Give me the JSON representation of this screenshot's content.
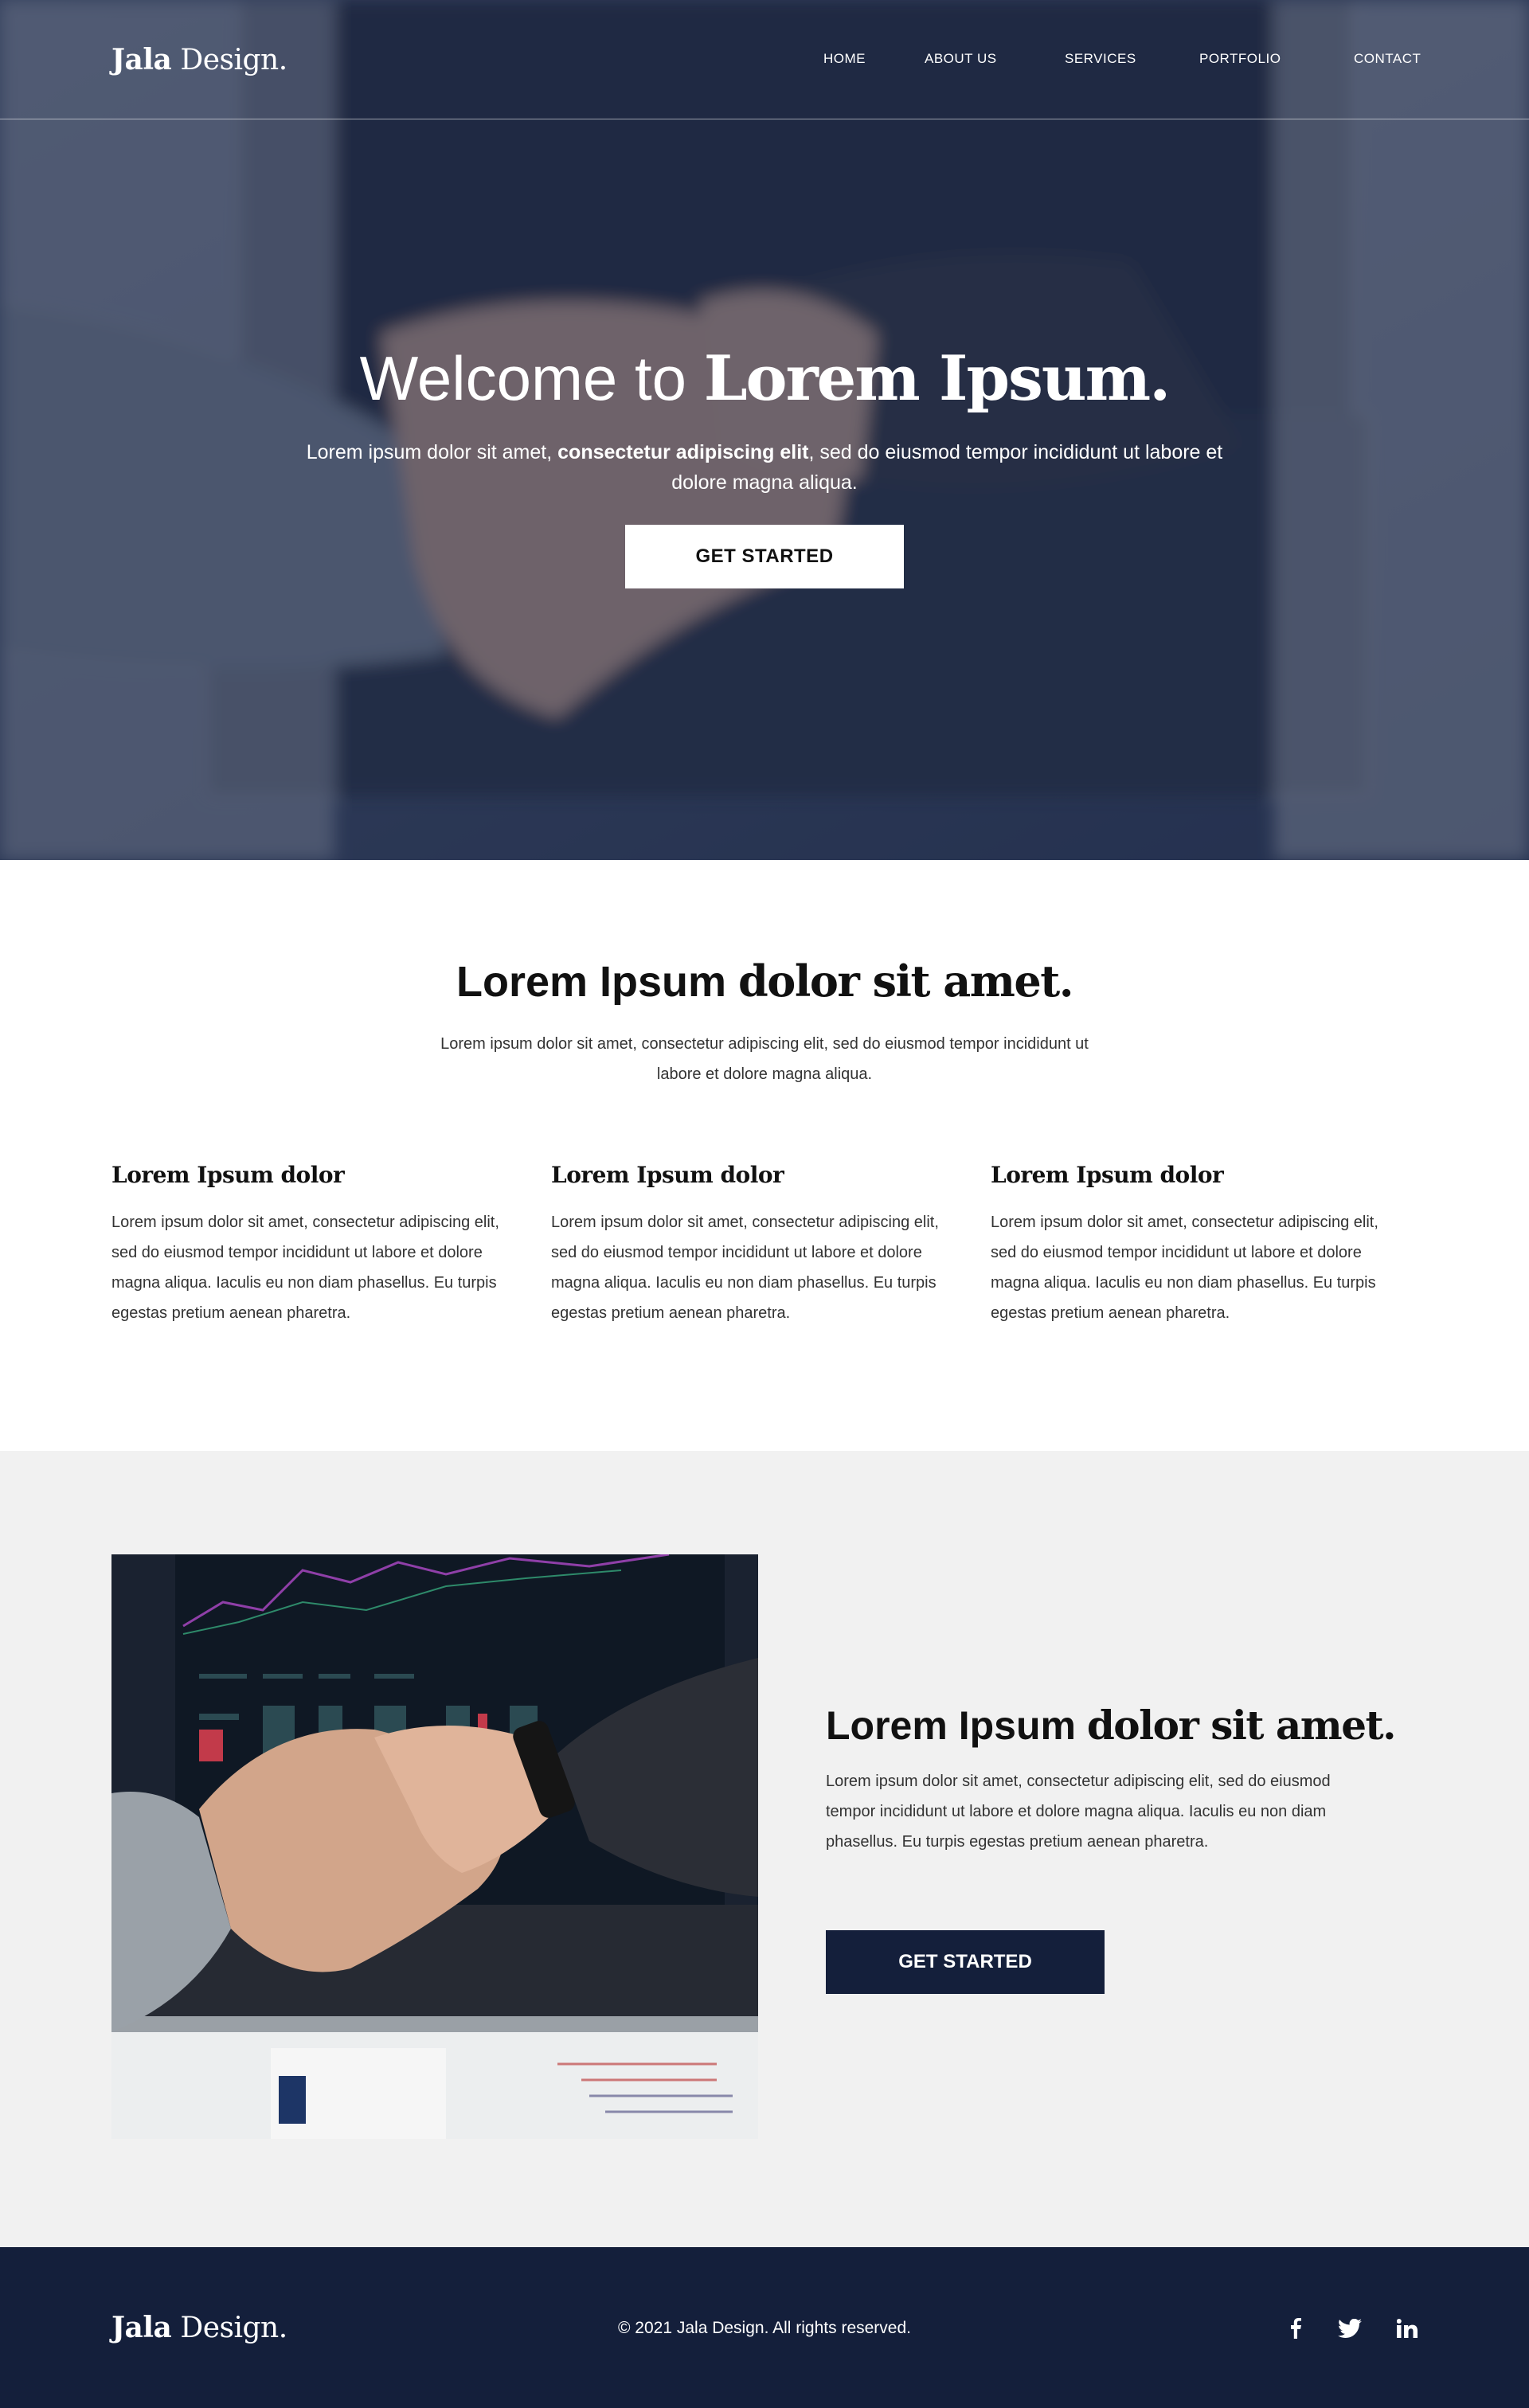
{
  "brand": {
    "logo_bold": "Jala",
    "logo_regular": "Design."
  },
  "nav": {
    "items": [
      {
        "label": "HOME"
      },
      {
        "label": "ABOUT US"
      },
      {
        "label": "SERVICES"
      },
      {
        "label": "PORTFOLIO"
      },
      {
        "label": "CONTACT"
      }
    ]
  },
  "hero": {
    "title_light": "Welcome to ",
    "title_bold": "Lorem Ipsum.",
    "subtitle_a": "Lorem ipsum dolor sit amet, ",
    "subtitle_bold": "consectetur adipiscing elit",
    "subtitle_b": ", sed do eiusmod tempor incididunt ut labore et dolore magna aliqua.",
    "cta": "GET STARTED",
    "image": "handshake-over-laptop-photo"
  },
  "intro": {
    "title_light": "Lorem Ipsum ",
    "title_bold": "dolor sit amet.",
    "subtitle": "Lorem ipsum dolor sit amet, consectetur adipiscing elit, sed do eiusmod tempor incididunt ut labore et dolore magna aliqua.",
    "columns": [
      {
        "title": "Lorem Ipsum dolor",
        "text": "Lorem ipsum dolor sit amet, consectetur adipiscing elit, sed do eiusmod tempor incididunt ut labore et dolore magna aliqua. Iaculis eu non diam phasellus. Eu turpis egestas pretium aenean pharetra."
      },
      {
        "title": "Lorem Ipsum dolor",
        "text": "Lorem ipsum dolor sit amet, consectetur adipiscing elit, sed do eiusmod tempor incididunt ut labore et dolore magna aliqua. Iaculis eu non diam phasellus. Eu turpis egestas pretium aenean pharetra."
      },
      {
        "title": "Lorem Ipsum dolor",
        "text": "Lorem ipsum dolor sit amet, consectetur adipiscing elit, sed do eiusmod tempor incididunt ut labore et dolore magna aliqua. Iaculis eu non diam phasellus. Eu turpis egestas pretium aenean pharetra."
      }
    ]
  },
  "feature": {
    "image": "handshake-over-laptop-photo",
    "title_light": "Lorem Ipsum ",
    "title_bold": "dolor sit amet.",
    "text": "Lorem ipsum dolor sit amet, consectetur adipiscing elit, sed do eiusmod tempor incididunt ut labore et dolore magna aliqua.  Iaculis eu non diam phasellus. Eu turpis egestas pretium aenean pharetra.",
    "cta": "GET STARTED"
  },
  "footer": {
    "copyright": "© 2021 Jala Design. All rights reserved.",
    "social": [
      "facebook-icon",
      "twitter-icon",
      "linkedin-icon"
    ]
  },
  "colors": {
    "navy": "#141f3b",
    "feature_bg": "#f1f1f1",
    "white": "#ffffff",
    "text": "#333333"
  }
}
